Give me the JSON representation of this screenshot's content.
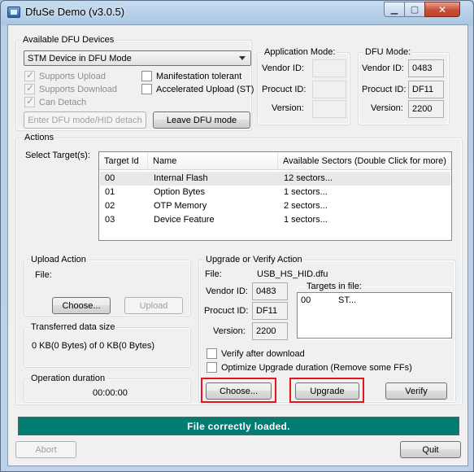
{
  "window": {
    "title": "DfuSe Demo (v3.0.5)"
  },
  "dfu_devices": {
    "label": "Available DFU Devices",
    "selected_device": "STM Device in DFU Mode",
    "supports_upload": "Supports Upload",
    "supports_download": "Supports Download",
    "can_detach": "Can Detach",
    "manifestation_tolerant": "Manifestation tolerant",
    "accelerated_upload": "Accelerated Upload (ST)",
    "enter_dfu_button": "Enter DFU mode/HID detach",
    "leave_dfu_button": "Leave DFU mode"
  },
  "app_mode": {
    "label": "Application Mode:",
    "vendor_id_label": "Vendor ID:",
    "product_id_label": "Procuct ID:",
    "version_label": "Version:",
    "vendor_id": "",
    "product_id": "",
    "version": ""
  },
  "dfu_mode": {
    "label": "DFU Mode:",
    "vendor_id_label": "Vendor ID:",
    "product_id_label": "Procuct ID:",
    "version_label": "Version:",
    "vendor_id": "0483",
    "product_id": "DF11",
    "version": "2200"
  },
  "actions": {
    "label": "Actions",
    "select_targets_label": "Select Target(s):",
    "columns": [
      "Target Id",
      "Name",
      "Available Sectors (Double Click for more)"
    ],
    "rows": [
      {
        "id": "00",
        "name": "Internal Flash",
        "sectors": "12 sectors..."
      },
      {
        "id": "01",
        "name": "Option Bytes",
        "sectors": "1 sectors..."
      },
      {
        "id": "02",
        "name": "OTP Memory",
        "sectors": "2 sectors..."
      },
      {
        "id": "03",
        "name": "Device Feature",
        "sectors": "1 sectors..."
      }
    ]
  },
  "upload_action": {
    "label": "Upload Action",
    "file_label": "File:",
    "choose_button": "Choose...",
    "upload_button": "Upload"
  },
  "transferred": {
    "label": "Transferred data size",
    "value": "0 KB(0 Bytes) of 0 KB(0 Bytes)"
  },
  "operation_duration": {
    "label": "Operation duration",
    "value": "00:00:00"
  },
  "upgrade_verify": {
    "label": "Upgrade or Verify Action",
    "file_label": "File:",
    "file_name": "USB_HS_HID.dfu",
    "vendor_id_label": "Vendor ID:",
    "product_id_label": "Procuct ID:",
    "version_label": "Version:",
    "vendor_id": "0483",
    "product_id": "DF11",
    "version": "2200",
    "targets_label": "Targets in file:",
    "target_id": "00",
    "target_name": "ST...",
    "verify_after_download": "Verify after download",
    "optimize_upgrade": "Optimize Upgrade duration (Remove some FFs)",
    "choose_button": "Choose...",
    "upgrade_button": "Upgrade",
    "verify_button": "Verify"
  },
  "status": {
    "message": "File correctly loaded."
  },
  "footer": {
    "abort_button": "Abort",
    "quit_button": "Quit"
  },
  "colors": {
    "status_bg": "#007c70",
    "highlight": "#e8141b"
  }
}
